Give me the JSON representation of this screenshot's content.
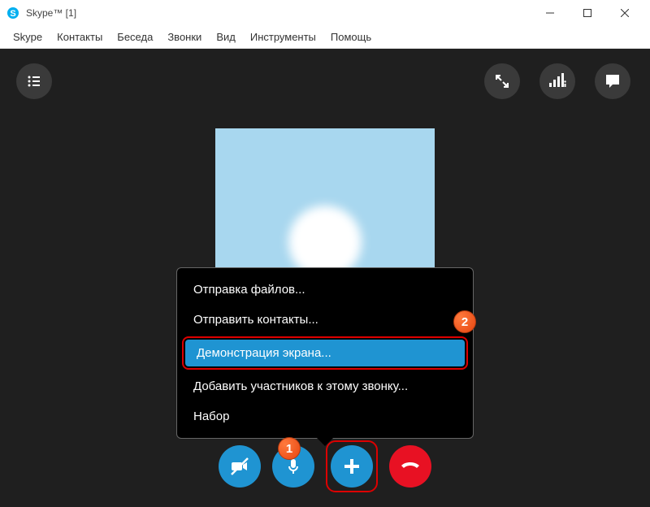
{
  "window": {
    "title": "Skype™ [1]"
  },
  "menubar": [
    "Skype",
    "Контакты",
    "Беседа",
    "Звонки",
    "Вид",
    "Инструменты",
    "Помощь"
  ],
  "popup": {
    "items": [
      "Отправка файлов...",
      "Отправить контакты...",
      "Демонстрация экрана...",
      "Добавить участников к этому звонку...",
      "Набор"
    ],
    "highlighted_index": 2
  },
  "badges": {
    "one": "1",
    "two": "2"
  },
  "colors": {
    "accent": "#1f94d2",
    "hangup": "#e81123",
    "callbg": "#1f1f1f",
    "avatar": "#a8d7ef"
  }
}
